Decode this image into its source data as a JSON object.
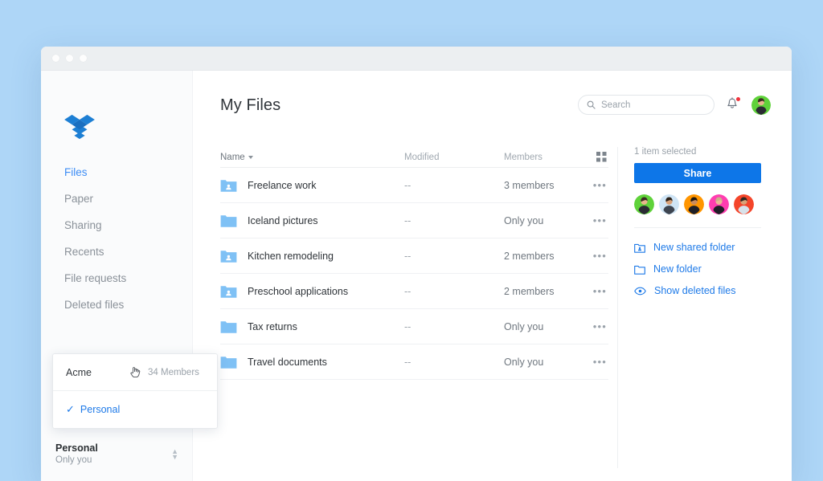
{
  "window": {
    "dots": [
      "close",
      "minimize",
      "maximize"
    ]
  },
  "sidebar": {
    "logo_name": "dropbox-logo",
    "items": [
      {
        "label": "Files",
        "active": true
      },
      {
        "label": "Paper",
        "active": false
      },
      {
        "label": "Sharing",
        "active": false
      },
      {
        "label": "Recents",
        "active": false
      },
      {
        "label": "File requests",
        "active": false
      },
      {
        "label": "Deleted files",
        "active": false
      }
    ],
    "account": {
      "name": "Personal",
      "sub": "Only you"
    }
  },
  "header": {
    "title": "My Files",
    "search_placeholder": "Search",
    "search_value": "",
    "search_icon": "search-icon",
    "bell_icon": "notification-bell-icon",
    "bell_has_badge": true,
    "avatar": "user-avatar"
  },
  "filelist": {
    "columns": {
      "name": "Name",
      "modified": "Modified",
      "members": "Members",
      "grid_icon": "grid-view-icon"
    },
    "sort_caret": "sort-descending-caret",
    "overflow_glyph": "•••",
    "rows": [
      {
        "name": "Freelance work",
        "modified": "--",
        "members": "3 members",
        "shared": true
      },
      {
        "name": "Iceland pictures",
        "modified": "--",
        "members": "Only you",
        "shared": false
      },
      {
        "name": "Kitchen remodeling",
        "modified": "--",
        "members": "2 members",
        "shared": true
      },
      {
        "name": "Preschool applications",
        "modified": "--",
        "members": "2 members",
        "shared": true
      },
      {
        "name": "Tax returns",
        "modified": "--",
        "members": "Only you",
        "shared": false
      },
      {
        "name": "Travel documents",
        "modified": "--",
        "members": "Only you",
        "shared": false
      }
    ]
  },
  "rightpanel": {
    "selection_label": "1 item selected",
    "share_label": "Share",
    "member_avatars": [
      {
        "name": "member-avatar-1",
        "bg": "#5fd23a"
      },
      {
        "name": "member-avatar-2",
        "bg": "#cfe4f5"
      },
      {
        "name": "member-avatar-3",
        "bg": "#ff9500"
      },
      {
        "name": "member-avatar-4",
        "bg": "#ff3eb0"
      },
      {
        "name": "member-avatar-5",
        "bg": "#f4452a"
      }
    ],
    "actions": [
      {
        "label": "New shared folder",
        "icon": "new-shared-folder-icon"
      },
      {
        "label": "New folder",
        "icon": "new-folder-icon"
      },
      {
        "label": "Show deleted files",
        "icon": "eye-icon"
      }
    ]
  },
  "popup": {
    "team": {
      "name": "Acme",
      "members": "34 Members"
    },
    "personal": {
      "name": "Personal",
      "checked": true
    },
    "cursor_icon": "pointing-hand-cursor"
  },
  "colors": {
    "page_bg": "#aed6f7",
    "accent": "#1e7ae8",
    "share_button": "#0d76e8",
    "folder_blue": "#7fc1f5",
    "badge_red": "#f0323c"
  }
}
